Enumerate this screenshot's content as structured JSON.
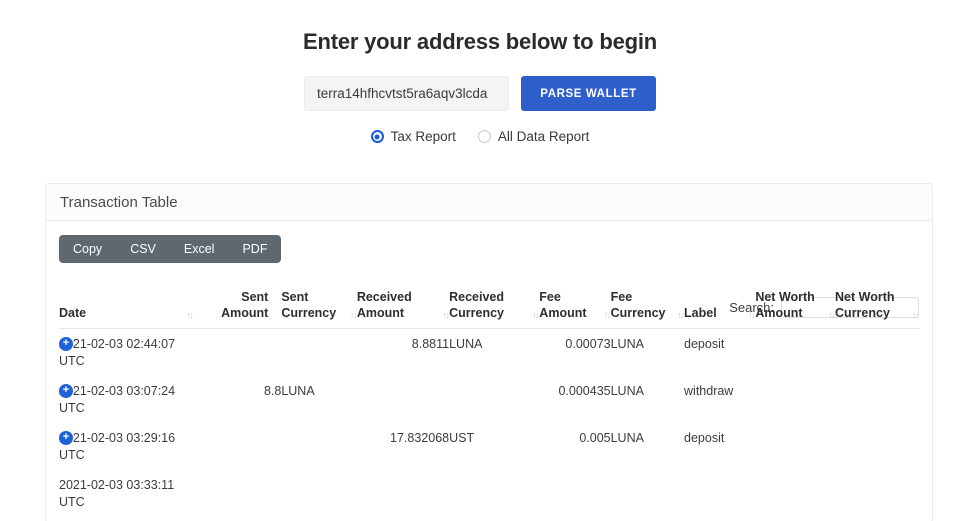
{
  "heading": "Enter your address below to begin",
  "form": {
    "address_value": "terra14hfhcvtst5ra6aqv3lcda",
    "address_placeholder": "terra14hfhcvtst5ra6aqv3lcda",
    "parse_button": "PARSE WALLET"
  },
  "report_options": [
    {
      "label": "Tax Report",
      "selected": true
    },
    {
      "label": "All Data Report",
      "selected": false
    }
  ],
  "card": {
    "title": "Transaction Table",
    "export_buttons": [
      "Copy",
      "CSV",
      "Excel",
      "PDF"
    ],
    "search": {
      "label": "Search:",
      "value": "",
      "placeholder": ""
    }
  },
  "table": {
    "sort_icon": "↑↓",
    "expand_icon": "+",
    "columns": [
      "Date",
      "Sent Amount",
      "Sent Currency",
      "Received Amount",
      "Received Currency",
      "Fee Amount",
      "Fee Currency",
      "Label",
      "Net Worth Amount",
      "Net Worth Currency"
    ],
    "rows": [
      {
        "date": "2021-02-03 02:44:07 UTC",
        "sent_amount": "",
        "sent_currency": "",
        "received_amount": "8.8811",
        "received_currency": "LUNA",
        "fee_amount": "0.00073",
        "fee_currency": "LUNA",
        "label": "deposit",
        "net_worth_amount": "",
        "net_worth_currency": ""
      },
      {
        "date": "2021-02-03 03:07:24 UTC",
        "sent_amount": "8.8",
        "sent_currency": "LUNA",
        "received_amount": "",
        "received_currency": "",
        "fee_amount": "0.000435",
        "fee_currency": "LUNA",
        "label": "withdraw",
        "net_worth_amount": "",
        "net_worth_currency": ""
      },
      {
        "date": "2021-02-03 03:29:16 UTC",
        "sent_amount": "",
        "sent_currency": "",
        "received_amount": "17.832068",
        "received_currency": "UST",
        "fee_amount": "0.005",
        "fee_currency": "LUNA",
        "label": "deposit",
        "net_worth_amount": "",
        "net_worth_currency": ""
      },
      {
        "date": "2021-02-03 03:33:11 UTC",
        "sent_amount": "",
        "sent_currency": "",
        "received_amount": "",
        "received_currency": "",
        "fee_amount": "",
        "fee_currency": "",
        "label": "",
        "net_worth_amount": "",
        "net_worth_currency": ""
      }
    ]
  },
  "colors": {
    "primary_blue": "#2f5fcb",
    "radio_blue": "#1d5ae0",
    "export_group": "#5f676f",
    "expand_badge": "#1f63d6"
  }
}
